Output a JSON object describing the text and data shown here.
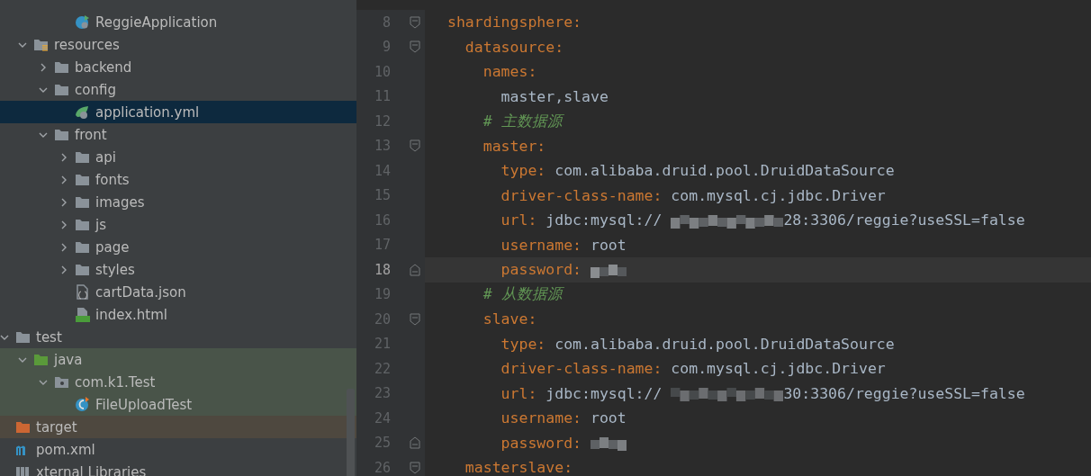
{
  "project_tree": {
    "items": [
      {
        "children": [
          {
            "children": [
              {
                "children": [
                  {
                    "children": [
                      {
                        "label": "ReggieApplication",
                        "kind": "spring-class"
                      }
                    ]
                  }
                ]
              },
              {
                "label": "resources",
                "kind": "resources-folder",
                "expanded": true,
                "children": [
                  {
                    "label": "backend",
                    "kind": "folder",
                    "expanded": false
                  },
                  {
                    "label": "config",
                    "kind": "folder",
                    "expanded": true,
                    "children": [
                      {
                        "label": "application.yml",
                        "kind": "yml",
                        "selected": true
                      }
                    ]
                  },
                  {
                    "label": "front",
                    "kind": "folder",
                    "expanded": true,
                    "children": [
                      {
                        "label": "api",
                        "kind": "folder",
                        "expanded": false
                      },
                      {
                        "label": "fonts",
                        "kind": "folder",
                        "expanded": false
                      },
                      {
                        "label": "images",
                        "kind": "folder",
                        "expanded": false
                      },
                      {
                        "label": "js",
                        "kind": "folder",
                        "expanded": false
                      },
                      {
                        "label": "page",
                        "kind": "folder",
                        "expanded": false
                      },
                      {
                        "label": "styles",
                        "kind": "folder",
                        "expanded": false
                      },
                      {
                        "label": "cartData.json",
                        "kind": "json"
                      },
                      {
                        "label": "index.html",
                        "kind": "html"
                      }
                    ]
                  }
                ]
              }
            ]
          },
          {
            "label": "test",
            "kind": "folder",
            "expanded": true,
            "children": [
              {
                "label": "java",
                "kind": "source-folder",
                "expanded": true,
                "color": "#495449",
                "children": [
                  {
                    "label": "com.k1.Test",
                    "kind": "package",
                    "expanded": true,
                    "color": "#495449",
                    "children": [
                      {
                        "label": "FileUploadTest",
                        "kind": "class",
                        "color": "#495449"
                      }
                    ]
                  }
                ]
              }
            ]
          }
        ]
      },
      {
        "label": "target",
        "kind": "excluded-folder",
        "color": "#4e483f"
      },
      {
        "label": "pom.xml",
        "kind": "maven"
      },
      {
        "label": "xternal Libraries",
        "kind": "library"
      }
    ]
  },
  "editor": {
    "lines": [
      {
        "number": "8",
        "fold_start": true,
        "tokens": [
          {
            "kind": "key",
            "text": "shardingsphere:"
          }
        ]
      },
      {
        "number": "9",
        "fold_start": true,
        "tokens": [
          {
            "kind": "key",
            "text": "  datasource:"
          }
        ]
      },
      {
        "number": "10",
        "tokens": [
          {
            "kind": "key",
            "text": "    names:"
          }
        ]
      },
      {
        "number": "11",
        "tokens": [
          {
            "kind": "value",
            "text": "      master,slave"
          }
        ]
      },
      {
        "number": "12",
        "tokens": [
          {
            "kind": "comment",
            "text": "    # 主数据源"
          }
        ]
      },
      {
        "number": "13",
        "fold_start": true,
        "tokens": [
          {
            "kind": "key",
            "text": "    master:"
          }
        ]
      },
      {
        "number": "14",
        "tokens": [
          {
            "kind": "key",
            "text": "      type:"
          },
          {
            "kind": "value",
            "text": " com.alibaba.druid.pool.DruidDataSource"
          }
        ]
      },
      {
        "number": "15",
        "tokens": [
          {
            "kind": "key",
            "text": "      driver-class-name:"
          },
          {
            "kind": "value",
            "text": " com.mysql.cj.jdbc.Driver"
          }
        ]
      },
      {
        "number": "16",
        "tokens": [
          {
            "kind": "key",
            "text": "      url:"
          },
          {
            "kind": "value",
            "text": " jdbc:mysql://"
          },
          {
            "kind": "redacted"
          },
          {
            "kind": "value",
            "text": "28:3306/reggie?useSSL=false"
          }
        ]
      },
      {
        "number": "17",
        "tokens": [
          {
            "kind": "key",
            "text": "      username:"
          },
          {
            "kind": "value",
            "text": " root"
          }
        ]
      },
      {
        "number": "18",
        "fold_end": true,
        "current": true,
        "tokens": [
          {
            "kind": "key",
            "text": "      password:"
          },
          {
            "kind": "redacted"
          }
        ]
      },
      {
        "number": "19",
        "tokens": [
          {
            "kind": "comment",
            "text": "    # 从数据源"
          }
        ]
      },
      {
        "number": "20",
        "fold_start": true,
        "tokens": [
          {
            "kind": "key",
            "text": "    slave:"
          }
        ]
      },
      {
        "number": "21",
        "tokens": [
          {
            "kind": "key",
            "text": "      type:"
          },
          {
            "kind": "value",
            "text": " com.alibaba.druid.pool.DruidDataSource"
          }
        ]
      },
      {
        "number": "22",
        "tokens": [
          {
            "kind": "key",
            "text": "      driver-class-name:"
          },
          {
            "kind": "value",
            "text": " com.mysql.cj.jdbc.Driver"
          }
        ]
      },
      {
        "number": "23",
        "tokens": [
          {
            "kind": "key",
            "text": "      url:"
          },
          {
            "kind": "value",
            "text": " jdbc:mysql://"
          },
          {
            "kind": "redacted"
          },
          {
            "kind": "value",
            "text": "30:3306/reggie?useSSL=false"
          }
        ]
      },
      {
        "number": "24",
        "tokens": [
          {
            "kind": "key",
            "text": "      username:"
          },
          {
            "kind": "value",
            "text": " root"
          }
        ]
      },
      {
        "number": "25",
        "fold_end": true,
        "tokens": [
          {
            "kind": "key",
            "text": "      password:"
          },
          {
            "kind": "redacted"
          }
        ]
      },
      {
        "number": "26",
        "fold_start": true,
        "tokens": [
          {
            "kind": "key",
            "text": "  masterslave:"
          }
        ]
      }
    ]
  }
}
